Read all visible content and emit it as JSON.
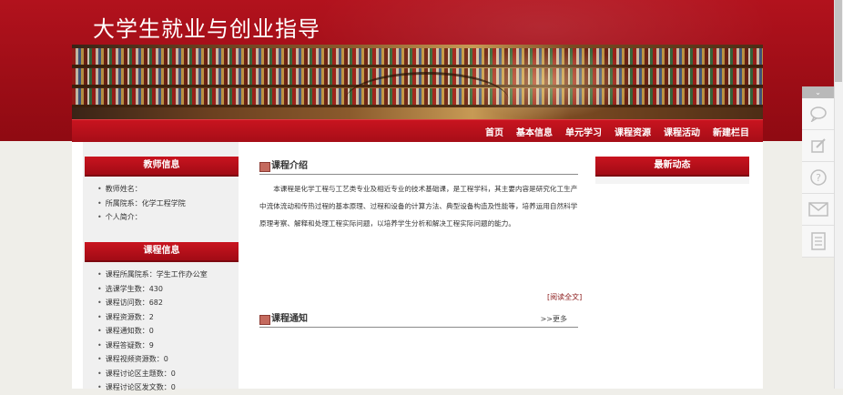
{
  "header": {
    "site_title": "大学生就业与创业指导"
  },
  "nav": {
    "items": [
      "首页",
      "基本信息",
      "单元学习",
      "课程资源",
      "课程活动",
      "新建栏目"
    ]
  },
  "teacher_info": {
    "title": "教师信息",
    "items": [
      "教师姓名：",
      "所属院系：化学工程学院",
      "个人简介："
    ]
  },
  "course_info": {
    "title": "课程信息",
    "items": [
      "课程所属院系：学生工作办公室",
      "选课学生数：430",
      "课程访问数：682",
      "课程资源数：2",
      "课程通知数：0",
      "课程答疑数：9",
      "课程视频资源数：0",
      "课程讨论区主题数：0",
      "课程讨论区发文数：0"
    ]
  },
  "course_intro": {
    "title": "课程介绍",
    "text": "本课程是化学工程与工艺类专业及相近专业的技术基础课，是工程学科，其主要内容是研究化工生产中流体流动和传热过程的基本原理、过程和设备的计算方法、典型设备构造及性能等，培养运用自然科学原理考察、解释和处理工程实际问题，以培养学生分析和解决工程实际问题的能力。",
    "read_more": "[阅读全文]"
  },
  "course_notice": {
    "title": "课程通知",
    "more": ">>更多"
  },
  "latest_news": {
    "title": "最新动态"
  },
  "side_tools": {
    "collapse": "⌄",
    "icons": [
      "chat-icon",
      "edit-icon",
      "help-icon",
      "mail-icon",
      "document-icon"
    ]
  },
  "colors": {
    "brand_red": "#b2121d",
    "nav_red": "#c8141f"
  }
}
